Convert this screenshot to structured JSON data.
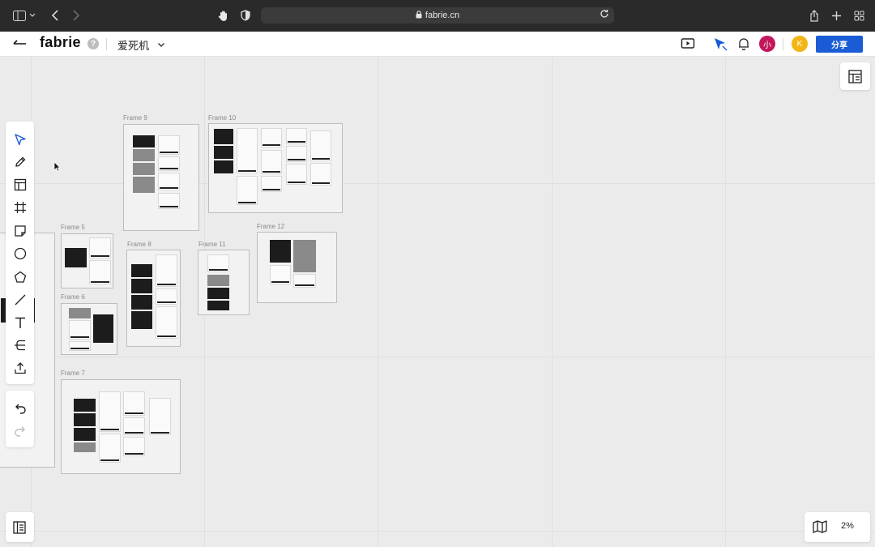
{
  "browser": {
    "url": "fabrie.cn"
  },
  "header": {
    "logo": "fabrie",
    "help": "?",
    "board_name": "爱死机",
    "avatar_1": "小",
    "avatar_2": "K",
    "share_label": "分享"
  },
  "frames": [
    {
      "label": "Frame 9"
    },
    {
      "label": "Frame 10"
    },
    {
      "label": "Frame 5"
    },
    {
      "label": "Frame 8"
    },
    {
      "label": "Frame 11"
    },
    {
      "label": "Frame 12"
    },
    {
      "label": "Frame 6"
    },
    {
      "label": "Frame 7"
    }
  ],
  "zoom": {
    "level": "2%"
  },
  "colors": {
    "accent": "#1a5cd6",
    "avatar_1": "#c2185b",
    "avatar_2": "#f2b515"
  },
  "icons": {
    "toolbar": [
      "select-icon",
      "pen-icon",
      "template-icon",
      "frame-icon",
      "sticky-note-icon",
      "circle-icon",
      "polygon-icon",
      "line-icon",
      "text-icon",
      "mindmap-icon",
      "upload-icon",
      "undo-icon",
      "redo-icon"
    ],
    "header": [
      "back-arrow-icon",
      "present-icon",
      "follow-cursor-icon",
      "bell-icon"
    ]
  }
}
